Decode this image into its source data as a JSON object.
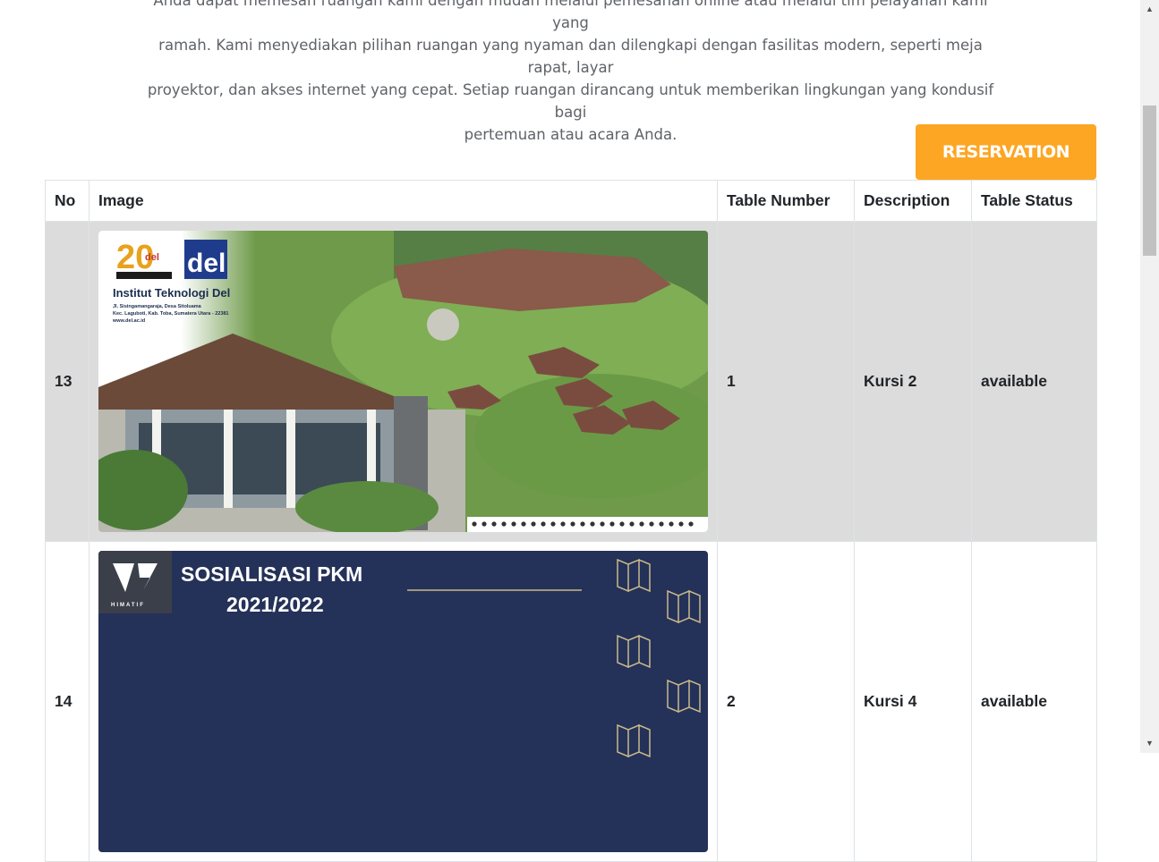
{
  "intro": {
    "line1": "Anda dapat memesan ruangan kami dengan mudah melalui pemesanan online atau melalui tim pelayanan kami yang",
    "line2": "ramah. Kami menyediakan pilihan ruangan yang nyaman dan dilengkapi dengan fasilitas modern, seperti meja rapat, layar",
    "line3": "proyektor, dan akses internet yang cepat. Setiap ruangan dirancang untuk memberikan lingkungan yang kondusif bagi",
    "line4": "pertemuan atau acara Anda."
  },
  "reservation_button": "RESERVATION",
  "table": {
    "headers": [
      "No",
      "Image",
      "Table Number",
      "Description",
      "Table Status"
    ],
    "rows": [
      {
        "no": "13",
        "table_number": "1",
        "description": "Kursi 2",
        "status": "available",
        "image": {
          "title": "Institut Teknologi Del",
          "address1": "Jl. Sisingamangaraja, Desa Sitoluama",
          "address2": "Kec. Laguboti, Kab. Toba, Sumatera Utara - 22381",
          "address3": "www.del.ac.id",
          "logo_text": "del",
          "anniv_text": "20",
          "anniv_small": "del"
        }
      },
      {
        "no": "14",
        "table_number": "2",
        "description": "Kursi 4",
        "status": "available",
        "image": {
          "title_line1": "SOSIALISASI PKM",
          "title_line2": "2021/2022",
          "logo_caption": "HIMATIF"
        }
      }
    ]
  },
  "colors": {
    "accent": "#fda623",
    "row_shade": "#dcdcdc",
    "banner_navy": "#243159"
  },
  "icons": {
    "scroll_up": "scroll-up-arrow-icon",
    "scroll_down": "scroll-down-arrow-icon"
  }
}
